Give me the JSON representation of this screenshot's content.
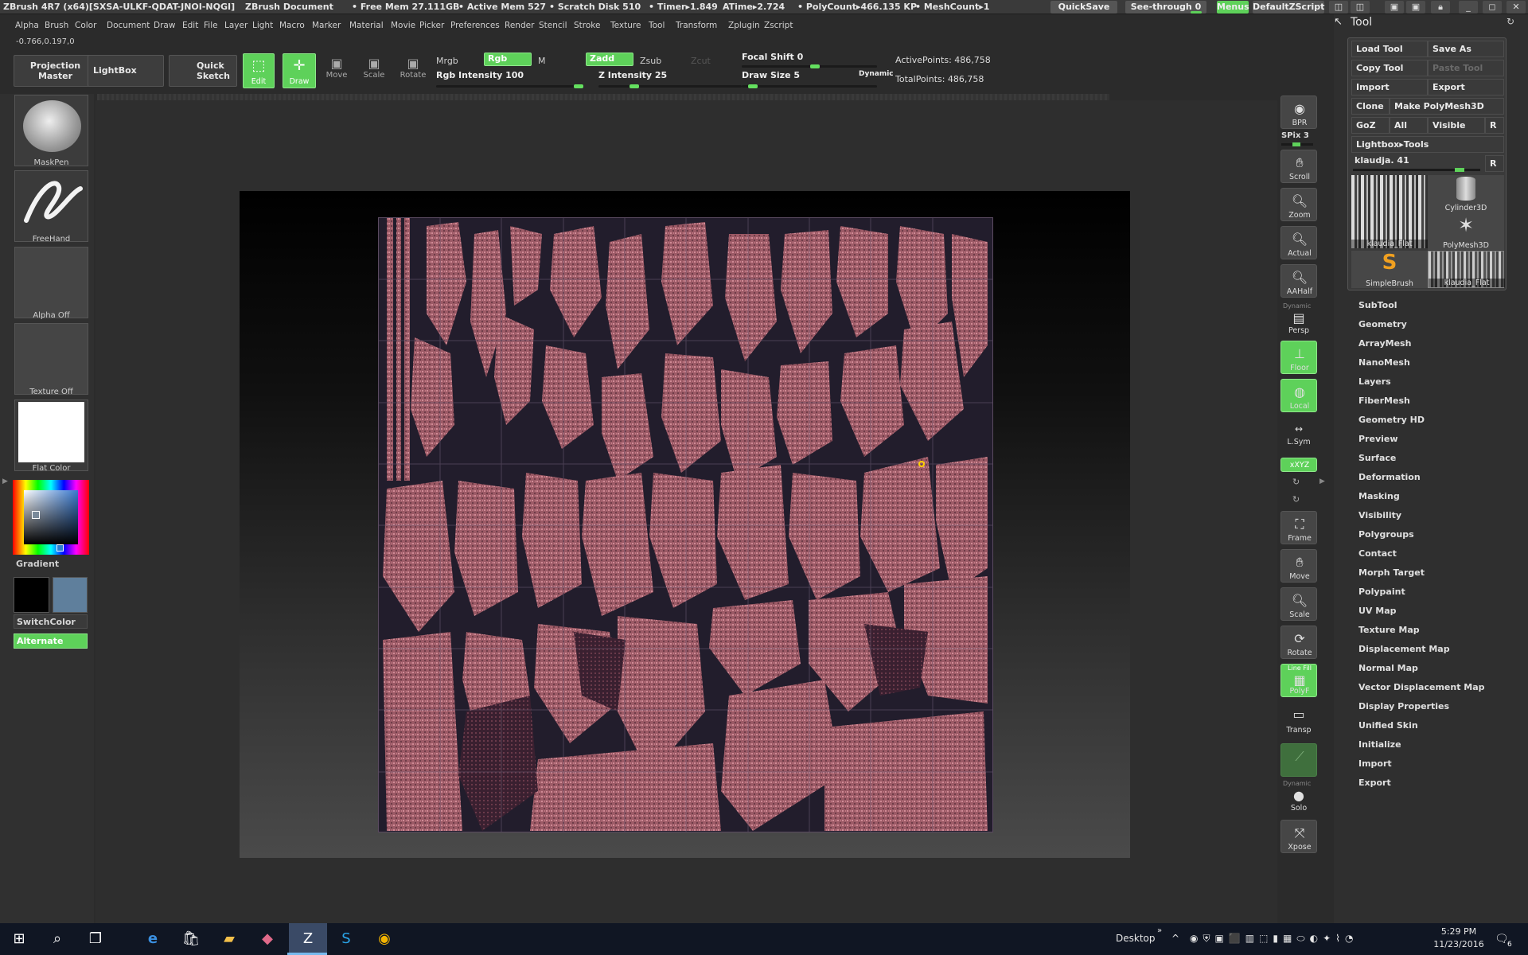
{
  "title_bar": {
    "app": "ZBrush 4R7 (x64)[SXSA-ULKF-QDAT-JNOI-NQGI]",
    "document": "ZBrush Document",
    "free_mem": "• Free Mem 27.111GB",
    "active_mem": "• Active Mem 527",
    "scratch_disk": "• Scratch Disk 510",
    "timer": "• Timer▸1.849",
    "atime": "ATime▸2.724",
    "polycount": "• PolyCount▸466.135 KP",
    "meshcount": "• MeshCount▸1",
    "quicksave": "QuickSave",
    "see_through": "See-through  0",
    "menus": "Menus",
    "script": "DefaultZScript"
  },
  "menu": [
    "Alpha",
    "Brush",
    "Color",
    "Document",
    "Draw",
    "Edit",
    "File",
    "Layer",
    "Light",
    "Macro",
    "Marker",
    "Material",
    "Movie",
    "Picker",
    "Preferences",
    "Render",
    "Stencil",
    "Stroke",
    "Texture",
    "Tool",
    "Transform",
    "Zplugin",
    "Zscript"
  ],
  "coords": "-0.766,0.197,0",
  "toolbar": {
    "projection_master": "Projection Master",
    "lightbox": "LightBox",
    "quick_sketch": "Quick Sketch",
    "edit": "Edit",
    "draw": "Draw",
    "move": "Move",
    "scale": "Scale",
    "rotate": "Rotate",
    "mrgb": "Mrgb",
    "rgb": "Rgb",
    "m": "M",
    "zadd": "Zadd",
    "zsub": "Zsub",
    "zcut": "Zcut",
    "rgb_intensity": "Rgb Intensity 100",
    "rgb_intensity_value": 100,
    "z_intensity": "Z Intensity 25",
    "z_intensity_value": 25,
    "focal_shift": "Focal Shift 0",
    "focal_shift_value": 0,
    "draw_size": "Draw Size 5",
    "draw_size_value": 5,
    "dynamic": "Dynamic",
    "active_points": "ActivePoints: 486,758",
    "total_points": "TotalPoints: 486,758"
  },
  "left_shelf": {
    "maskpen": "MaskPen",
    "freehand": "FreeHand",
    "alpha": "Alpha Off",
    "texture": "Texture Off",
    "material": "Flat Color",
    "gradient": "Gradient",
    "switchcolor": "SwitchColor",
    "alternate": "Alternate"
  },
  "right_shelf": {
    "bpr": "BPR",
    "spix": "SPix 3",
    "scroll": "Scroll",
    "zoom": "Zoom",
    "actual": "Actual",
    "aahalf": "AAHalf",
    "dynamic": "Dynamic",
    "persp": "Persp",
    "floor": "Floor",
    "local": "Local",
    "lsym": "L.Sym",
    "xyz": "xXYZ",
    "frame": "Frame",
    "move": "Move",
    "scale": "Scale",
    "rotate": "Rotate",
    "linefill": "Line Fill",
    "polyf": "PolyF",
    "transp": "Transp",
    "dynamic2": "Dynamic",
    "solo": "Solo",
    "xpose": "Xpose"
  },
  "tool_panel": {
    "title": "Tool",
    "load_tool": "Load Tool",
    "save_as": "Save As",
    "copy_tool": "Copy Tool",
    "paste_tool": "Paste Tool",
    "import": "Import",
    "export": "Export",
    "clone": "Clone",
    "make_polymesh": "Make PolyMesh3D",
    "goz": "GoZ",
    "all": "All",
    "visible": "Visible",
    "r": "R",
    "lightbox_tools": "Lightbox▸Tools",
    "current_tool": "klaudja. 41",
    "thumbs": [
      "klaudia_Flat",
      "Cylinder3D",
      "PolyMesh3D",
      "SimpleBrush",
      "klaudia_Flat"
    ],
    "sections": [
      "SubTool",
      "Geometry",
      "ArrayMesh",
      "NanoMesh",
      "Layers",
      "FiberMesh",
      "Geometry HD",
      "Preview",
      "Surface",
      "Deformation",
      "Masking",
      "Visibility",
      "Polygroups",
      "Contact",
      "Morph Target",
      "Polypaint",
      "UV Map",
      "Texture Map",
      "Displacement Map",
      "Normal Map",
      "Vector Displacement Map",
      "Display Properties",
      "Unified Skin",
      "Initialize",
      "Import",
      "Export"
    ]
  },
  "taskbar": {
    "desktop": "Desktop",
    "time": "5:29 PM",
    "date": "11/23/2016",
    "notifications": "6"
  },
  "colors": {
    "accent_green": "#5ed15a",
    "uv_pink": "#b5707a",
    "primary_color": "#000000",
    "secondary_color": "#5f7f9c"
  }
}
